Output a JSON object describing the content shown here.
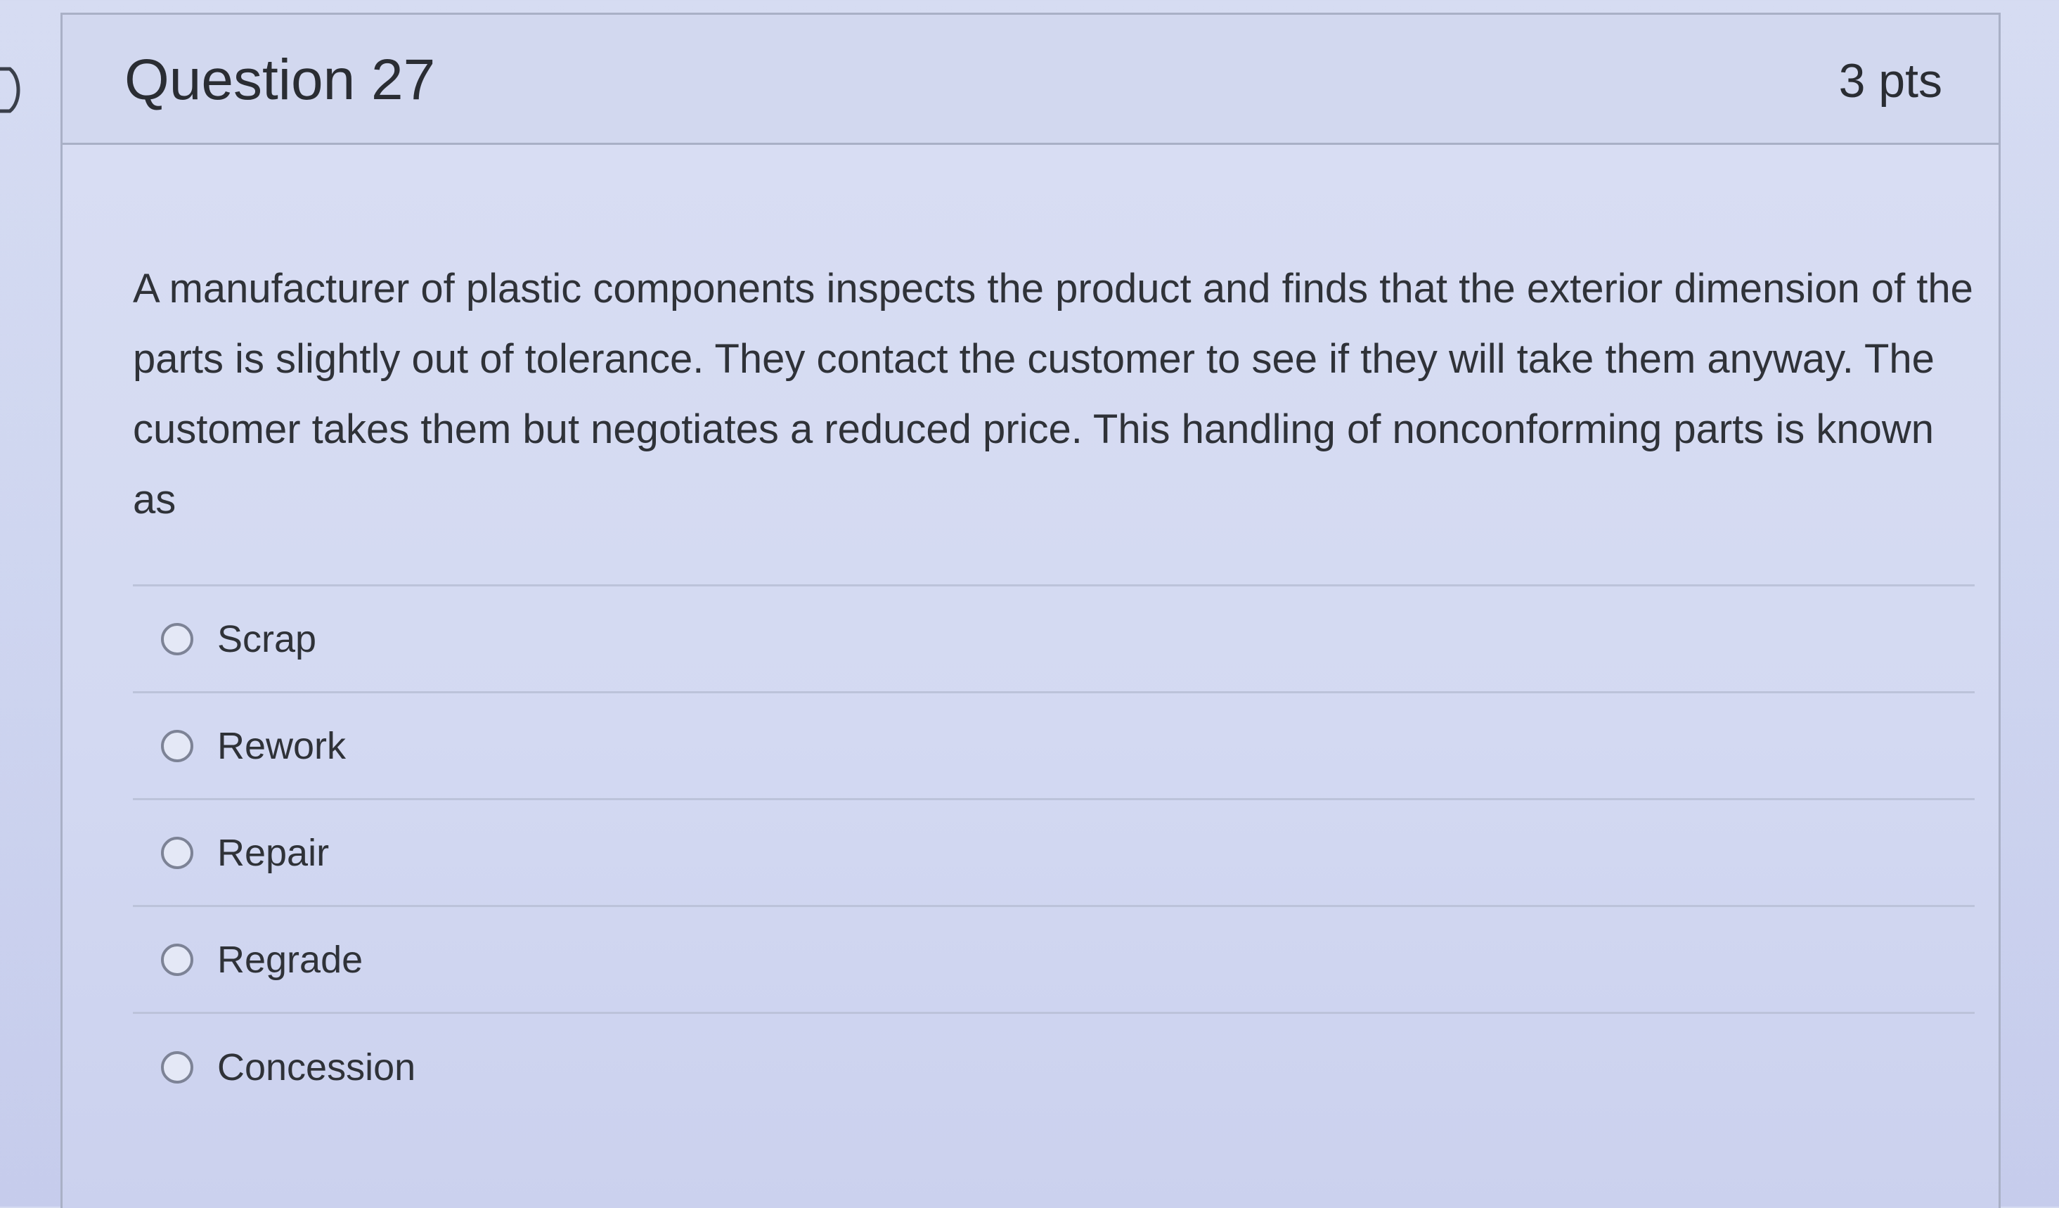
{
  "question": {
    "title": "Question 27",
    "points": "3 pts",
    "text": "A manufacturer of plastic components inspects the product and finds that the exterior dimension of the parts is slightly out of tolerance. They contact the customer to see if they will take them anyway. The customer takes them but negotiates a reduced price. This handling of nonconforming parts is known as",
    "answers": [
      {
        "label": "Scrap"
      },
      {
        "label": "Rework"
      },
      {
        "label": "Repair"
      },
      {
        "label": "Regrade"
      },
      {
        "label": "Concession"
      }
    ]
  },
  "icons": {
    "flag": "flag-icon",
    "radio": "radio-unchecked-icon"
  }
}
